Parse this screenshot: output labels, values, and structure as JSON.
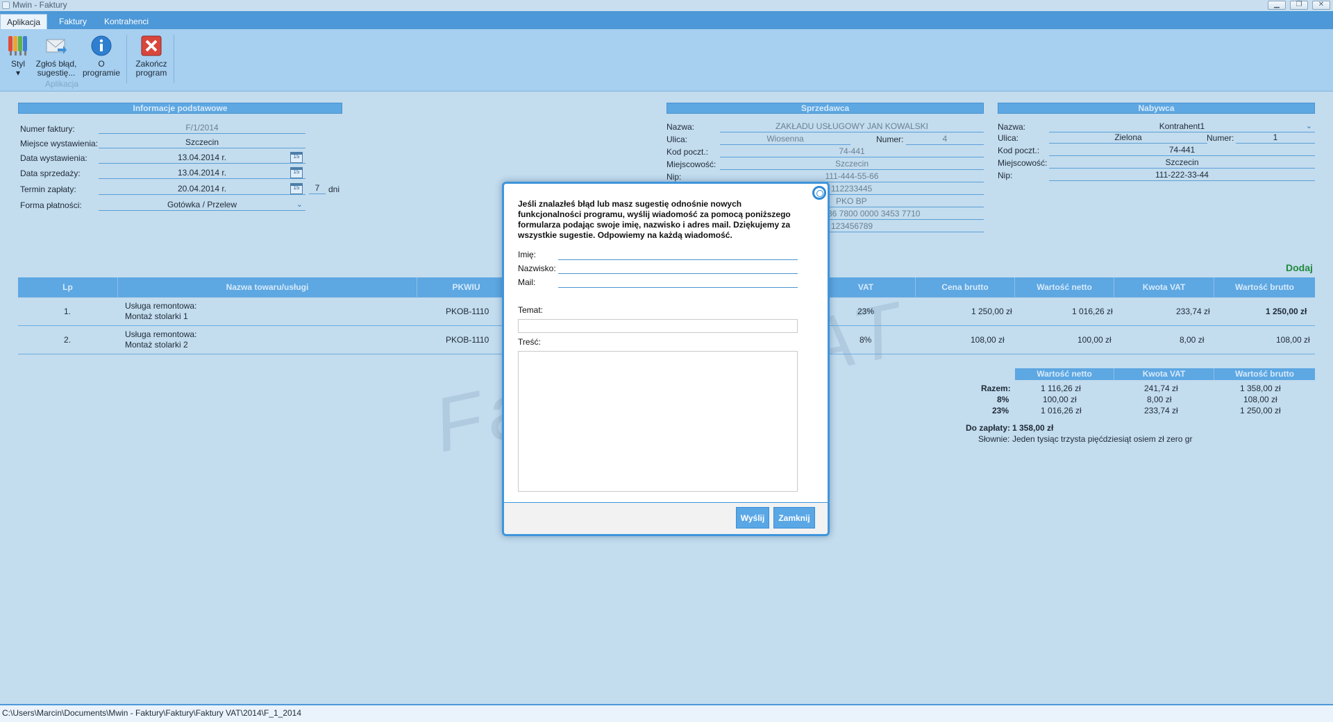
{
  "window": {
    "title": "Mwin - Faktury",
    "controls": [
      "▁",
      "❐",
      "✕"
    ]
  },
  "tabs": [
    "Aplikacja",
    "Faktury",
    "Kontrahenci"
  ],
  "ribbon": {
    "buttons": [
      {
        "label": "Styl",
        "sub": "▾",
        "icon": "palette-icon"
      },
      {
        "label": "Zgłoś błąd,",
        "sub": "sugestię...",
        "icon": "mail-icon"
      },
      {
        "label": "O",
        "sub": "programie",
        "icon": "info-icon"
      },
      {
        "label": "Zakończ",
        "sub": "program",
        "icon": "exit-icon"
      }
    ],
    "group_label": "Aplikacja"
  },
  "info": {
    "header": "Informacje podstawowe",
    "invoice_number_label": "Numer faktury:",
    "invoice_number": "F/1/2014",
    "place_label": "Miejsce wystawienia:",
    "place": "Szczecin",
    "issue_date_label": "Data wystawienia:",
    "issue_date": "13.04.2014 r.",
    "sale_date_label": "Data sprzedaży:",
    "sale_date": "13.04.2014 r.",
    "due_date_label": "Termin zapłaty:",
    "due_date": "20.04.2014 r.",
    "due_days": "7",
    "days_label": "dni",
    "payment_label": "Forma płatności:",
    "payment": "Gotówka / Przelew",
    "calendar_day": "15"
  },
  "seller": {
    "header": "Sprzedawca",
    "name_label": "Nazwa:",
    "name": "ZAKŁADU USŁUGOWY JAN KOWALSKI",
    "street_label": "Ulica:",
    "street": "Wiosenna",
    "number_label": "Numer:",
    "number": "4",
    "postal_label": "Kod poczt.:",
    "postal": "74-441",
    "city_label": "Miejscowość:",
    "city": "Szczecin",
    "nip_label": "Nip:",
    "nip": "111-444-55-66",
    "extra1": "112233445",
    "bank": "PKO BP",
    "account": "36 7800 0000 3453 7710",
    "extra2": "123456789"
  },
  "buyer": {
    "header": "Nabywca",
    "name_label": "Nazwa:",
    "name": "Kontrahent1",
    "street_label": "Ulica:",
    "street": "Zielona",
    "number_label": "Numer:",
    "number": "1",
    "postal_label": "Kod poczt.:",
    "postal": "74-441",
    "city_label": "Miejscowość:",
    "city": "Szczecin",
    "nip_label": "Nip:",
    "nip": "111-222-33-44"
  },
  "add_label": "Dodaj",
  "table": {
    "headers": [
      "Lp",
      "Nazwa towaru/usługi",
      "PKWIU",
      "VAT",
      "Cena brutto",
      "Wartość netto",
      "Kwota VAT",
      "Wartość brutto"
    ],
    "rows": [
      {
        "lp": "1.",
        "name1": "Usługa remontowa:",
        "name2": "Montaż stolarki 1",
        "pkwiu": "PKOB-1110",
        "vat": "23%",
        "cena_brutto": "1 250,00 zł",
        "netto": "1 016,26 zł",
        "kwota_vat": "233,74 zł",
        "brutto": "1 250,00 zł"
      },
      {
        "lp": "2.",
        "name1": "Usługa remontowa:",
        "name2": "Montaż stolarki 2",
        "pkwiu": "PKOB-1110",
        "vat": "8%",
        "cena_brutto": "108,00 zł",
        "netto": "100,00 zł",
        "kwota_vat": "8,00 zł",
        "brutto": "108,00 zł"
      }
    ]
  },
  "summary": {
    "headers": [
      "Wartość netto",
      "Kwota VAT",
      "Wartość brutto"
    ],
    "rows": [
      {
        "label": "Razem:",
        "netto": "1 116,26 zł",
        "vat": "241,74 zł",
        "brutto": "1 358,00 zł"
      },
      {
        "label": "8%",
        "netto": "100,00 zł",
        "vat": "8,00 zł",
        "brutto": "108,00 zł"
      },
      {
        "label": "23%",
        "netto": "1 016,26 zł",
        "vat": "233,74 zł",
        "brutto": "1 250,00 zł"
      }
    ],
    "to_pay_label": "Do zapłaty:",
    "to_pay": "1 358,00 zł",
    "words_label": "Słownie:",
    "words": "Jeden tysiąc trzysta pięćdziesiąt osiem zł zero gr"
  },
  "watermark": "Faktura VAT",
  "modal": {
    "message": "Jeśli znalazłeś błąd lub masz sugestię odnośnie nowych funkcjonalności programu, wyślij wiadomość za pomocą poniższego formularza podając swoje imię, nazwisko i adres mail. Dziękujemy za wszystkie sugestie. Odpowiemy na każdą wiadomość.",
    "first_name_label": "Imię:",
    "first_name": "",
    "last_name_label": "Nazwisko:",
    "last_name": "",
    "mail_label": "Mail:",
    "mail": "",
    "subject_label": "Temat:",
    "subject": "",
    "content_label": "Treść:",
    "content": "",
    "send_label": "Wyślij",
    "close_label": "Zamknij"
  },
  "status_path": "C:\\Users\\Marcin\\Documents\\Mwin - Faktury\\Faktury\\Faktury VAT\\2014\\F_1_2014"
}
